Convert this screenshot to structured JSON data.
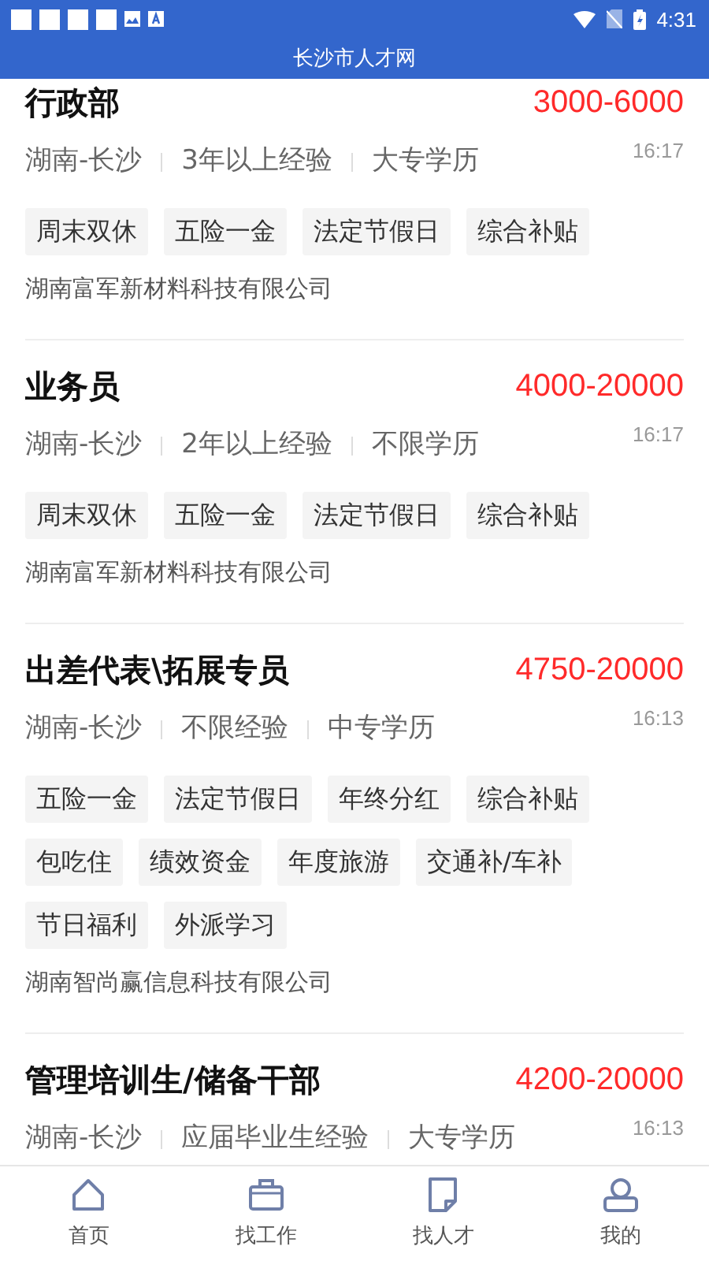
{
  "status_bar": {
    "time": "4:31"
  },
  "header": {
    "title": "长沙市人才网"
  },
  "jobs": [
    {
      "title": "行政部",
      "salary": "3000-6000",
      "meta": [
        "湖南-长沙",
        "3年以上经验",
        "大专学历"
      ],
      "time": "16:17",
      "tags": [
        "周末双休",
        "五险一金",
        "法定节假日",
        "综合补贴"
      ],
      "company": "湖南富军新材料科技有限公司"
    },
    {
      "title": "业务员",
      "salary": "4000-20000",
      "meta": [
        "湖南-长沙",
        "2年以上经验",
        "不限学历"
      ],
      "time": "16:17",
      "tags": [
        "周末双休",
        "五险一金",
        "法定节假日",
        "综合补贴"
      ],
      "company": "湖南富军新材料科技有限公司"
    },
    {
      "title": "出差代表\\拓展专员",
      "salary": "4750-20000",
      "meta": [
        "湖南-长沙",
        "不限经验",
        "中专学历"
      ],
      "time": "16:13",
      "tags": [
        "五险一金",
        "法定节假日",
        "年终分红",
        "综合补贴",
        "包吃住",
        "绩效资金",
        "年度旅游",
        "交通补/车补",
        "节日福利",
        "外派学习"
      ],
      "company": "湖南智尚赢信息科技有限公司"
    },
    {
      "title": "管理培训生/储备干部",
      "salary": "4200-20000",
      "meta": [
        "湖南-长沙",
        "应届毕业生经验",
        "大专学历"
      ],
      "time": "16:13"
    }
  ],
  "bottom_nav": [
    {
      "kind": "home",
      "label": "首页"
    },
    {
      "kind": "briefcase",
      "label": "找工作"
    },
    {
      "kind": "note",
      "label": "找人才"
    },
    {
      "kind": "person",
      "label": "我的"
    }
  ]
}
